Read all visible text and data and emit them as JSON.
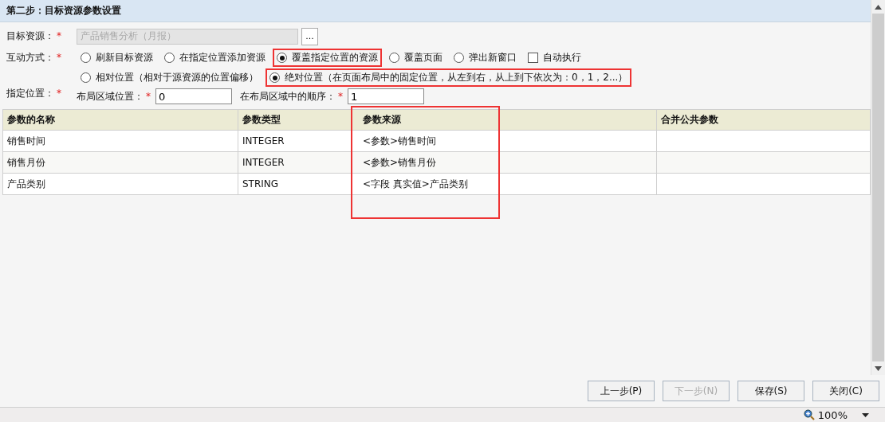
{
  "header": {
    "title": "第二步：目标资源参数设置"
  },
  "target_resource": {
    "label": "目标资源：",
    "required_mark": "*",
    "value": "产品销售分析（月报）",
    "disabled": true,
    "browse_button": "..."
  },
  "interaction": {
    "label": "互动方式：",
    "required_mark": "*",
    "options": [
      {
        "kind": "radio",
        "label": "刷新目标资源",
        "selected": false,
        "highlighted": false
      },
      {
        "kind": "radio",
        "label": "在指定位置添加资源",
        "selected": false,
        "highlighted": false
      },
      {
        "kind": "radio",
        "label": "覆盖指定位置的资源",
        "selected": true,
        "highlighted": true
      },
      {
        "kind": "radio",
        "label": "覆盖页面",
        "selected": false,
        "highlighted": false
      },
      {
        "kind": "radio",
        "label": "弹出新窗口",
        "selected": false,
        "highlighted": false
      },
      {
        "kind": "checkbox",
        "label": "自动执行",
        "checked": false,
        "highlighted": false
      }
    ]
  },
  "position": {
    "label": "指定位置：",
    "required_mark": "*",
    "options": [
      {
        "label": "相对位置（相对于源资源的位置偏移）",
        "selected": false,
        "highlighted": false
      },
      {
        "label": "绝对位置（在页面布局中的固定位置，从左到右，从上到下依次为：0，1，2...）",
        "selected": true,
        "highlighted": true
      }
    ],
    "fields": [
      {
        "label": "布局区域位置：",
        "required_mark": "*",
        "value": "0"
      },
      {
        "label": "在布局区域中的顺序：",
        "required_mark": "*",
        "value": "1"
      }
    ]
  },
  "table": {
    "columns": [
      {
        "label": "参数的名称",
        "highlighted": false
      },
      {
        "label": "参数类型",
        "highlighted": false
      },
      {
        "label": "参数来源",
        "highlighted": true
      },
      {
        "label": "合并公共参数",
        "highlighted": false
      }
    ],
    "rows": [
      [
        "销售时间",
        "INTEGER",
        "<参数>销售时间"
      ],
      [
        "销售月份",
        "INTEGER",
        "<参数>销售月份"
      ],
      [
        "产品类别",
        "STRING",
        "<字段 真实值>产品类别"
      ]
    ]
  },
  "buttons": [
    {
      "label": "上一步(P)",
      "disabled": false
    },
    {
      "label": "下一步(N)",
      "disabled": true
    },
    {
      "label": "保存(S)",
      "disabled": false
    },
    {
      "label": "关闭(C)",
      "disabled": false
    }
  ],
  "status_bar": {
    "zoom": "100%"
  }
}
